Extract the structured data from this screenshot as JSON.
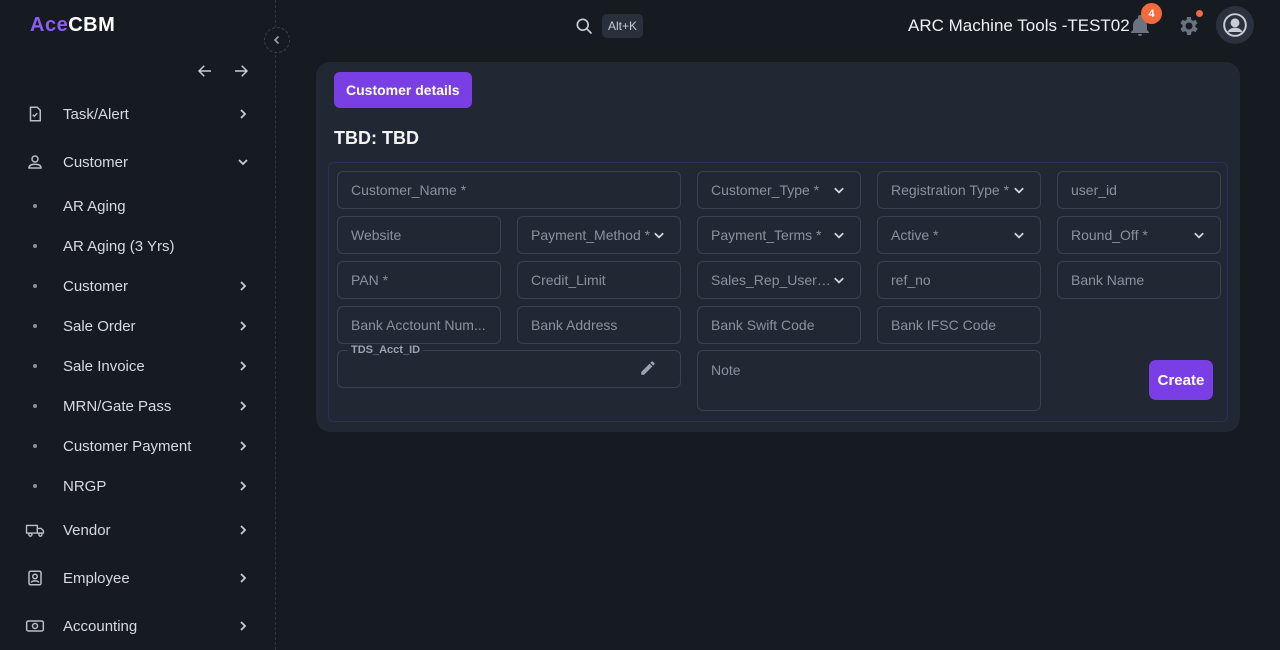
{
  "app": {
    "logo_left": "Ace",
    "logo_right": "CBM",
    "company": "ARC Machine Tools -TEST02",
    "search_shortcut": "Alt+K",
    "notification_count": "4"
  },
  "sidebar": {
    "items": [
      {
        "label": "Task/Alert",
        "icon": "clipboard-check-icon",
        "expandable": true
      },
      {
        "label": "Customer",
        "icon": "person-icon",
        "expanded": true
      },
      {
        "label": "AR Aging",
        "sub": true
      },
      {
        "label": "AR Aging (3 Yrs)",
        "sub": true
      },
      {
        "label": "Customer",
        "sub": true,
        "expandable": true
      },
      {
        "label": "Sale Order",
        "sub": true,
        "expandable": true
      },
      {
        "label": "Sale Invoice",
        "sub": true,
        "expandable": true
      },
      {
        "label": "MRN/Gate Pass",
        "sub": true,
        "expandable": true
      },
      {
        "label": "Customer Payment",
        "sub": true,
        "expandable": true
      },
      {
        "label": "NRGP",
        "sub": true,
        "expandable": true
      },
      {
        "label": "Vendor",
        "icon": "truck-icon",
        "expandable": true
      },
      {
        "label": "Employee",
        "icon": "id-badge-icon",
        "expandable": true
      },
      {
        "label": "Accounting",
        "icon": "money-icon",
        "expandable": true
      }
    ]
  },
  "main": {
    "tab_label": "Customer details",
    "title": "TBD: TBD",
    "fields": {
      "customer_name": "Customer_Name *",
      "customer_type": "Customer_Type *",
      "registration_type": "Registration Type *",
      "user_id": "user_id",
      "website": "Website",
      "payment_method": "Payment_Method *",
      "payment_terms": "Payment_Terms *",
      "active": "Active *",
      "round_off": "Round_Off *",
      "pan": "PAN *",
      "credit_limit": "Credit_Limit",
      "sales_rep": "Sales_Rep_User_Grp",
      "ref_no": "ref_no",
      "bank_name": "Bank Name",
      "bank_account": "Bank Acctount Num...",
      "bank_address": "Bank Address",
      "bank_swift": "Bank Swift Code",
      "bank_ifsc": "Bank IFSC Code",
      "tds_label": "TDS_Acct_ID",
      "note": "Note"
    },
    "create_label": "Create"
  },
  "colors": {
    "accent": "#7a3fe4",
    "badge": "#f26a3d",
    "background": "#161b22",
    "card": "#222833"
  }
}
